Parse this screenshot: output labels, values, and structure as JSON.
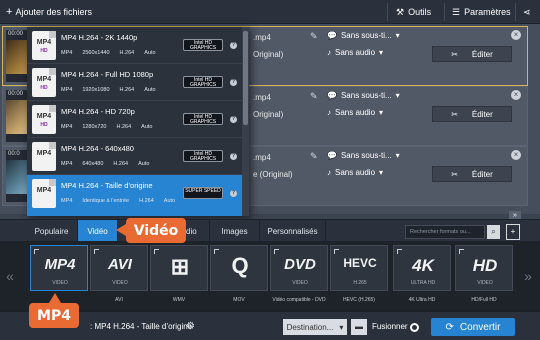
{
  "toolbar": {
    "add_files": "Ajouter des fichiers",
    "tools": "Outils",
    "settings": "Paramètres"
  },
  "files": [
    {
      "duration": "00:00",
      "format": ".mp4",
      "original": "Original)",
      "subtitles": "Sans sous-ti...",
      "audio": "Sans audio",
      "edit": "Éditer",
      "thumb_color": "#a07a3a"
    },
    {
      "duration": "00:00",
      "format": ".mp4",
      "original": "Original)",
      "subtitles": "Sans sous-ti...",
      "audio": "Sans audio",
      "edit": "Éditer",
      "thumb_color": "#c4a36a"
    },
    {
      "duration": "00:0",
      "format": ".mp4",
      "original": "e (Original)",
      "subtitles": "Sans sous-ti...",
      "audio": "Sans audio",
      "edit": "Éditer",
      "thumb_color": "#5f8aa0"
    }
  ],
  "presets": [
    {
      "title": "MP4 H.264 - 2K 1440p",
      "icon_top": "MP4",
      "icon_bottom": "HD",
      "meta": [
        "MP4",
        "2560x1440",
        "H.264",
        "Auto"
      ],
      "badge": "Intel HD GRAPHICS",
      "active": false
    },
    {
      "title": "MP4 H.264 - Full HD 1080p",
      "icon_top": "MP4",
      "icon_bottom": "HD",
      "meta": [
        "MP4",
        "1920x1080",
        "H.264",
        "Auto"
      ],
      "badge": "Intel HD GRAPHICS",
      "active": false
    },
    {
      "title": "MP4 H.264 - HD 720p",
      "icon_top": "MP4",
      "icon_bottom": "HD",
      "meta": [
        "MP4",
        "1280x720",
        "H.264",
        "Auto"
      ],
      "badge": "Intel HD GRAPHICS",
      "active": false
    },
    {
      "title": "MP4 H.264 - 640x480",
      "icon_top": "MP4",
      "icon_bottom": "",
      "meta": [
        "MP4",
        "640x480",
        "H.264",
        "Auto"
      ],
      "badge": "Intel HD GRAPHICS",
      "active": false
    },
    {
      "title": "MP4 H.264 - Taille d’origine",
      "icon_top": "MP4",
      "icon_bottom": "",
      "meta": [
        "MP4",
        "Identique à l’entrée",
        "H.264",
        "Auto"
      ],
      "badge": "SUPER SPEED",
      "active": true
    }
  ],
  "tabs": {
    "popular": "Populaire",
    "video": "Vidéo",
    "audio": "dio",
    "images": "Images",
    "custom": "Personnalisés",
    "search_placeholder": "Rechercher formats ou..."
  },
  "formats": [
    {
      "logo": "MP4",
      "sub": "VIDEO",
      "label": ""
    },
    {
      "logo": "AVI",
      "sub": "VIDEO",
      "label": "AVI"
    },
    {
      "logo": "⊞",
      "sub": "",
      "label": "WMV"
    },
    {
      "logo": "Q",
      "sub": "",
      "label": "MOV"
    },
    {
      "logo": "DVD",
      "sub": "VIDEO",
      "label": "Vidéo compatible - DVD"
    },
    {
      "logo": "HEVC",
      "sub": "H.265",
      "label": "HEVC (H.265)"
    },
    {
      "logo": "4K",
      "sub": "ULTRA HD",
      "label": "4K Ultra HD"
    },
    {
      "logo": "HD",
      "sub": "VIDEO",
      "label": "HD/Full HD"
    }
  ],
  "bottom": {
    "output_label": ": MP4 H.264 - Taille d’origine",
    "destination": "Destination...",
    "merge": "Fusionner",
    "convert": "Convertir"
  },
  "callouts": {
    "video": "Vidéo",
    "mp4": "MP4"
  },
  "colors": {
    "accent": "#2784d2",
    "callout": "#ea6a34",
    "selected_border": "#d6b45a"
  }
}
